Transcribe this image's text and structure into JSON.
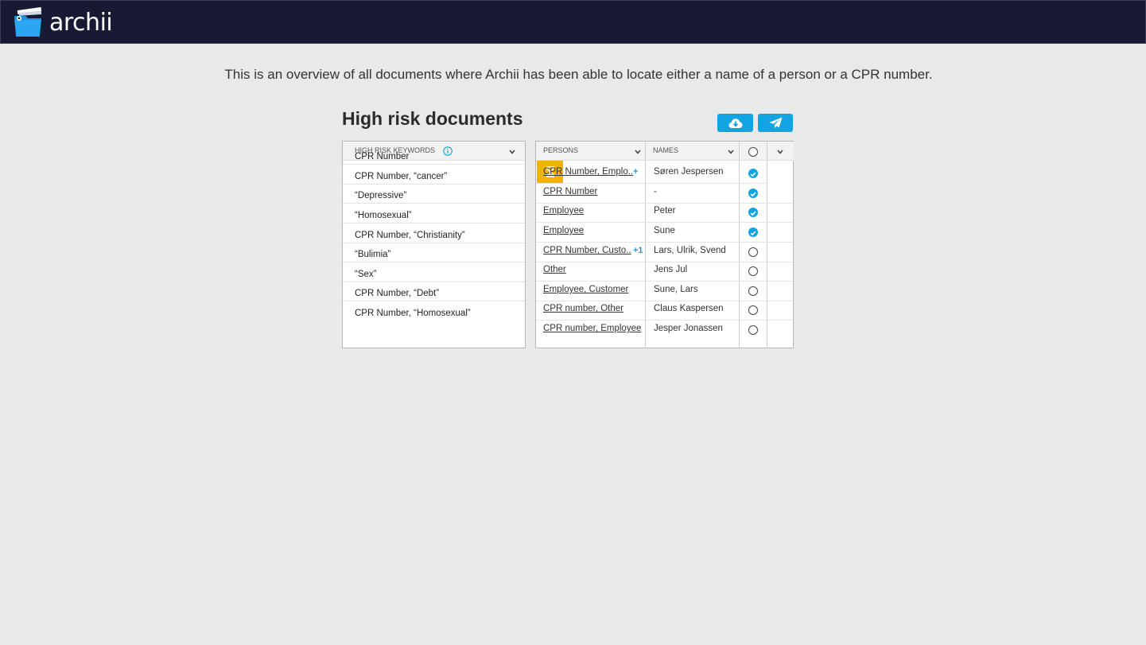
{
  "app": {
    "brand": "archii"
  },
  "intro": "This is an overview of all documents where Archii has been able to locate either a name of a person or a CPR number.",
  "title": "High risk documents",
  "toolbar": {
    "download_icon": "cloud-download-icon",
    "send_icon": "paper-plane-icon"
  },
  "keywords_table": {
    "header": "HIGH RISK KEYWORDS",
    "rows": [
      "CPR Number",
      "CPR Number, “cancer”",
      "“Depressive”",
      " “Homosexual”",
      " CPR Number, “Christianity”",
      " “Bulimia”",
      " “Sex”",
      " CPR Number, “Debt”",
      " CPR Number, “Homosexual”"
    ]
  },
  "persons_table": {
    "persons_header": "PERSONS",
    "names_header": "NAMES",
    "rows": [
      {
        "persons": "CPR Number, Emplo..",
        "extra": "+",
        "names": "Søren Jespersen",
        "checked": true
      },
      {
        "persons": "CPR Number",
        "extra": "",
        "names": "-",
        "checked": true
      },
      {
        "persons": "Employee",
        "extra": "",
        "names": "Peter",
        "checked": true
      },
      {
        "persons": "Employee",
        "extra": "",
        "names": "Sune",
        "checked": true
      },
      {
        "persons": "CPR Number, Custo..",
        "extra": "+1",
        "names": "Lars, Ulrik, Svend",
        "checked": false
      },
      {
        "persons": "Other",
        "extra": "",
        "names": "Jens Jul",
        "checked": false
      },
      {
        "persons": "Employee, Customer",
        "extra": "",
        "names": "Sune, Lars",
        "checked": false
      },
      {
        "persons": "CPR number, Other",
        "extra": "",
        "names": "Claus Kaspersen",
        "checked": false
      },
      {
        "persons": "CPR number, Employee",
        "extra": "",
        "names": "Jesper Jonassen",
        "checked": false
      }
    ],
    "status_icon": "hourglass-icon",
    "accent": "#12a3e3",
    "status_color": "#f0b400"
  }
}
